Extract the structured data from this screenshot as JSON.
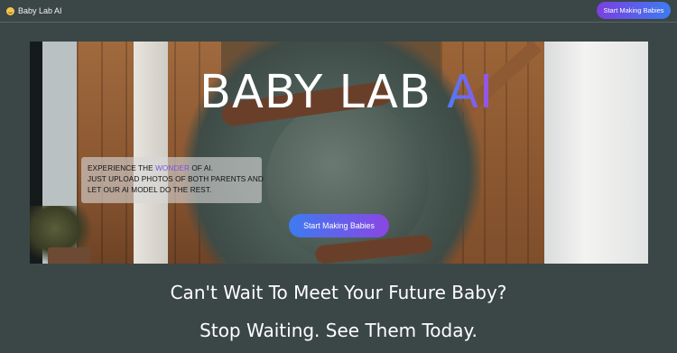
{
  "header": {
    "brand_icon": "baby-face-emoji",
    "brand_name": "Baby Lab AI",
    "cta_label": "Start Making Babies"
  },
  "hero": {
    "title_main": "BABY LAB ",
    "title_accent": "AI",
    "info": {
      "line1_before": "EXPERIENCE THE ",
      "line1_highlight": "WONDER",
      "line1_after": " OF AI.",
      "line2": "JUST UPLOAD PHOTOS OF BOTH PARENTS AND",
      "line3": "LET OUR AI MODEL DO THE REST."
    },
    "cta_label": "Start Making Babies"
  },
  "tagline": {
    "line1": "Can't Wait To Meet Your Future Baby?",
    "line2": "Stop Waiting. See Them Today."
  },
  "colors": {
    "background": "#3b4646",
    "accent_gradient_start": "#3e7bf0",
    "accent_gradient_end": "#8a46e3",
    "highlight": "#7c53e0"
  }
}
